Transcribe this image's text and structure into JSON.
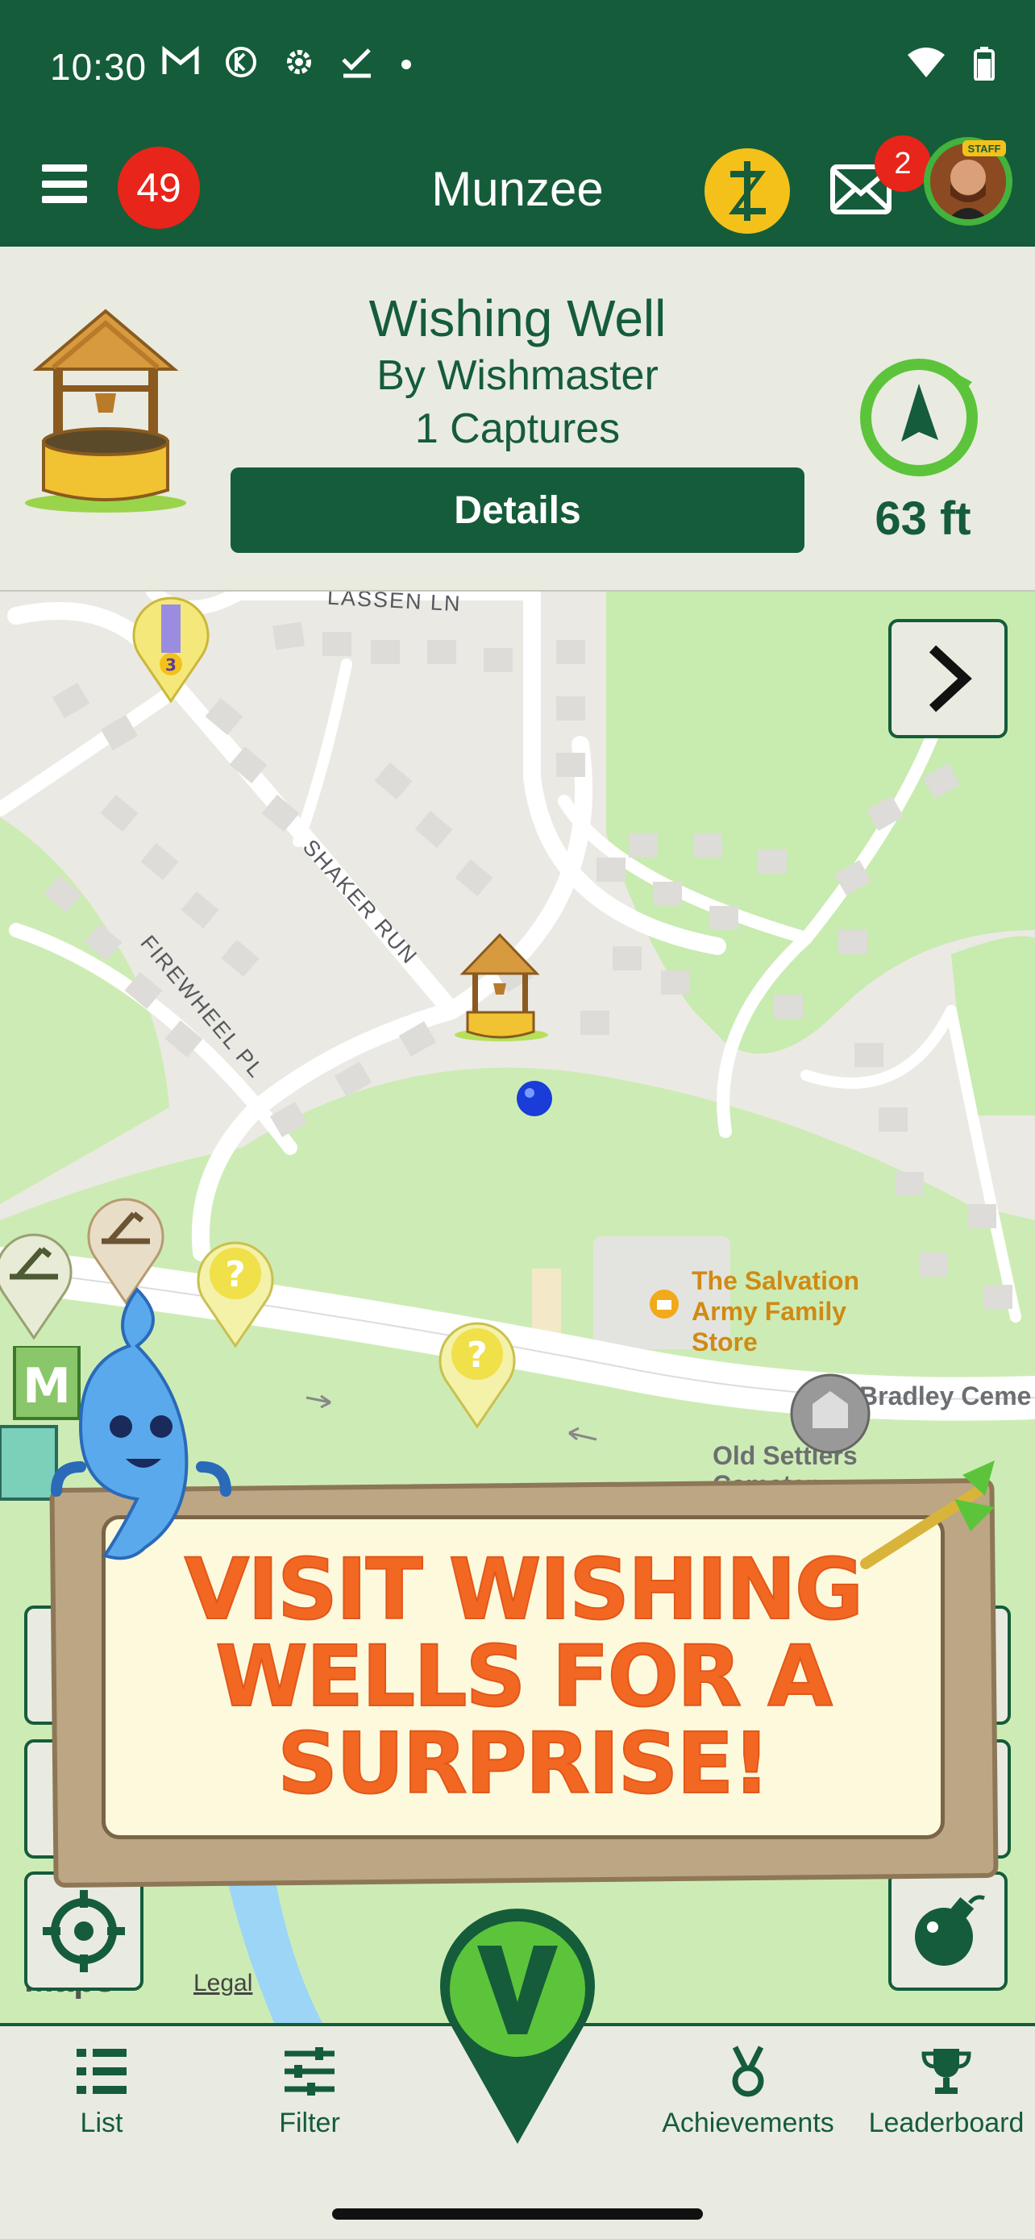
{
  "status_bar": {
    "time": "10:30"
  },
  "app_bar": {
    "notification_count": "49",
    "title": "Munzee",
    "mail_count": "2",
    "staff_tag": "STAFF"
  },
  "info_card": {
    "title": "Wishing Well",
    "owner": "By Wishmaster",
    "captures": "1 Captures",
    "details_label": "Details",
    "distance": "63 ft"
  },
  "map": {
    "streets": {
      "lassen": "LASSEN LN",
      "shaker": "SHAKER RUN",
      "firewheel": "FIREWHEEL PL"
    },
    "poi_store": [
      "The Salvation",
      "Army Family",
      "Store"
    ],
    "poi_cemetery": "Bradley Ceme",
    "poi_old": "Old Settlers",
    "poi_old_2": "Cemetery",
    "legal": "Legal",
    "watermark": "Maps",
    "map_pin_count": "3"
  },
  "banner": {
    "line1": "VISIT WISHING",
    "line2": "WELLS FOR A",
    "line3": "SURPRISE!"
  },
  "bottom_nav": {
    "items": [
      {
        "label": "List",
        "icon": "list-icon"
      },
      {
        "label": "Filter",
        "icon": "filter-icon"
      },
      {
        "label": "Achievements",
        "icon": "medal-icon"
      },
      {
        "label": "Leaderboard",
        "icon": "trophy-icon"
      }
    ]
  },
  "colors": {
    "brand_green": "#155c3a",
    "badge_red": "#e8251a",
    "banner_orange": "#f26722"
  }
}
